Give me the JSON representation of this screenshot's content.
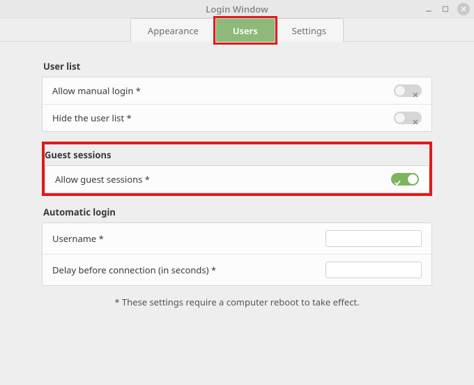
{
  "window": {
    "title": "Login Window"
  },
  "tabs": {
    "appearance": "Appearance",
    "users": "Users",
    "settings": "Settings"
  },
  "sections": {
    "user_list": {
      "title": "User list",
      "allow_manual_login": {
        "label": "Allow manual login *",
        "value": false
      },
      "hide_user_list": {
        "label": "Hide the user list *",
        "value": false
      }
    },
    "guest_sessions": {
      "title": "Guest sessions",
      "allow_guest": {
        "label": "Allow guest sessions *",
        "value": true
      }
    },
    "automatic_login": {
      "title": "Automatic login",
      "username": {
        "label": "Username *",
        "value": ""
      },
      "delay": {
        "label": "Delay before connection (in seconds) *",
        "value": ""
      }
    }
  },
  "footnote": "* These settings require a computer reboot to take effect."
}
